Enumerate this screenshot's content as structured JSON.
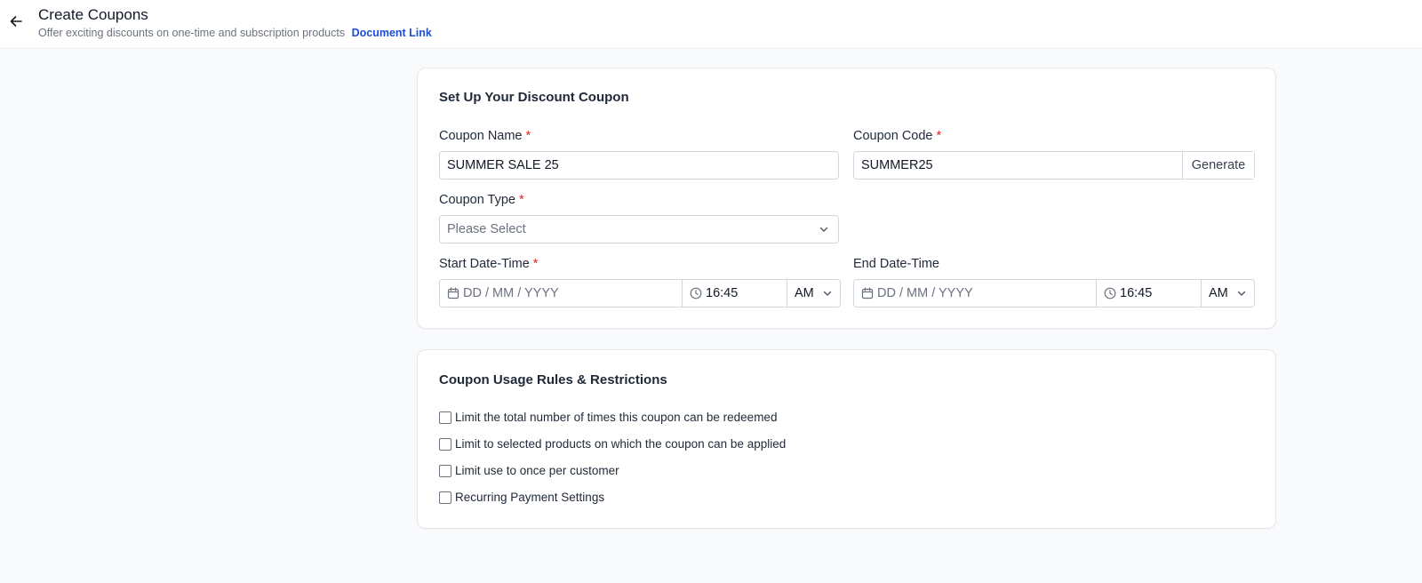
{
  "header": {
    "title": "Create Coupons",
    "subtitle": "Offer exciting discounts on one-time and subscription products",
    "doc_link": "Document Link"
  },
  "setup": {
    "title": "Set Up Your Discount Coupon",
    "coupon_name": {
      "label": "Coupon Name",
      "required": "*",
      "value": "SUMMER SALE 25"
    },
    "coupon_code": {
      "label": "Coupon Code",
      "required": "*",
      "value": "SUMMER25",
      "generate_label": "Generate"
    },
    "coupon_type": {
      "label": "Coupon Type",
      "required": "*",
      "placeholder": "Please Select"
    },
    "start": {
      "label": "Start Date-Time",
      "required": "*",
      "date_placeholder": "DD / MM / YYYY",
      "time": "16:45",
      "meridiem": "AM"
    },
    "end": {
      "label": "End Date-Time",
      "date_placeholder": "DD / MM / YYYY",
      "time": "16:45",
      "meridiem": "AM"
    }
  },
  "rules": {
    "title": "Coupon Usage Rules & Restrictions",
    "options": [
      {
        "label": "Limit the total number of times this coupon can be redeemed",
        "checked": false
      },
      {
        "label": "Limit to selected products on which the coupon can be applied",
        "checked": false
      },
      {
        "label": "Limit use to once per customer",
        "checked": false
      },
      {
        "label": "Recurring Payment Settings",
        "checked": false
      }
    ]
  },
  "colors": {
    "accent_link": "#1d4ed8",
    "required": "#dc2626",
    "background": "#f8fafc"
  },
  "icons": {
    "back": "arrow-left-icon",
    "calendar": "calendar-icon",
    "clock": "clock-icon",
    "chevron": "chevron-down-icon"
  }
}
